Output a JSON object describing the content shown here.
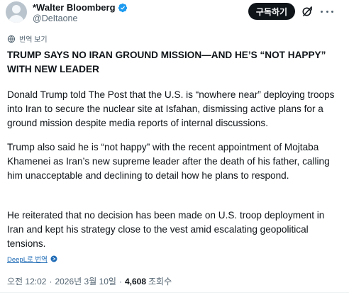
{
  "author": {
    "display_name": "*Walter Bloomberg",
    "handle": "@DeItaone",
    "verified": true
  },
  "actions": {
    "subscribe_label": "구독하기",
    "icons": [
      "grok-icon",
      "more-icon"
    ]
  },
  "translate": {
    "label": "번역 보기"
  },
  "post": {
    "headline": "TRUMP SAYS NO IRAN GROUND MISSION—AND HE’S “NOT HAPPY” WITH NEW LEADER",
    "paragraphs": [
      "Donald Trump told The Post that the U.S. is “nowhere near” deploying troops into Iran to secure the nuclear site at Isfahan, dismissing active plans for a ground mission despite media reports of internal discussions.",
      "Trump also said he is “not happy” with the recent appointment of Mojtaba Khamenei as Iran’s new supreme leader after the death of his father, calling him unacceptable and declining to detail how he plans to respond.",
      "He reiterated that no decision has been made on U.S. troop deployment in Iran and kept his strategy close to the vest amid escalating geopolitical tensions."
    ],
    "deepl_label": "DeepL로 번역"
  },
  "meta": {
    "time": "오전 12:02",
    "date": "2026년 3월 10일",
    "views_count": "4,608",
    "views_label": "조회수"
  },
  "colors": {
    "verified": "#1d9bf0",
    "text": "#0f1419",
    "muted": "#536471",
    "button_bg": "#0f1419"
  }
}
